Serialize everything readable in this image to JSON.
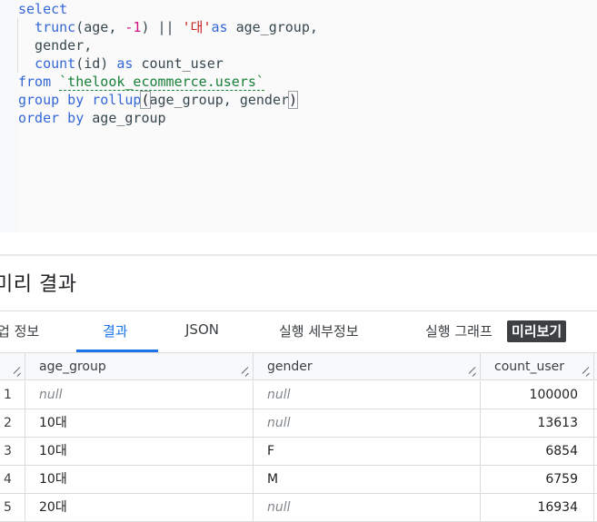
{
  "editor": {
    "lines": [
      [
        {
          "t": "select",
          "c": "kw"
        }
      ],
      [
        {
          "t": "  "
        },
        {
          "t": "trunc",
          "c": "fn"
        },
        {
          "t": "(age, ",
          "c": "plain"
        },
        {
          "t": "-1",
          "c": "num"
        },
        {
          "t": ") || ",
          "c": "plain"
        },
        {
          "t": "'대'",
          "c": "str"
        },
        {
          "t": "as",
          "c": "kw"
        },
        {
          "t": " age_group,",
          "c": "plain"
        }
      ],
      [
        {
          "t": "  gender,",
          "c": "plain"
        }
      ],
      [
        {
          "t": "  "
        },
        {
          "t": "count",
          "c": "fn"
        },
        {
          "t": "(id) ",
          "c": "plain"
        },
        {
          "t": "as",
          "c": "kw"
        },
        {
          "t": " count_user",
          "c": "plain"
        }
      ],
      [
        {
          "t": "from",
          "c": "kw"
        },
        {
          "t": " "
        },
        {
          "t": "`thelook_ecommerce.users`",
          "c": "tbl"
        }
      ],
      [
        {
          "t": "group by",
          "c": "kw"
        },
        {
          "t": " "
        },
        {
          "t": "rollup",
          "c": "fn"
        },
        {
          "t": "(",
          "c": "paren-box"
        },
        {
          "t": "age_group, gender",
          "c": "plain"
        },
        {
          "t": ")",
          "c": "paren-box"
        }
      ],
      [
        {
          "t": "order by",
          "c": "kw"
        },
        {
          "t": " age_group",
          "c": "plain"
        }
      ]
    ]
  },
  "results": {
    "title": "미리 결과",
    "tabs": [
      {
        "label": "업 정보"
      },
      {
        "label": "결과"
      },
      {
        "label": "JSON"
      },
      {
        "label": "실행 세부정보"
      },
      {
        "label": "실행 그래프"
      }
    ],
    "preview_badge": "미리보기",
    "columns": [
      "age_group",
      "gender",
      "count_user"
    ],
    "rows": [
      {
        "num": "1",
        "age_group": "null",
        "gender": "null",
        "count_user": "100000"
      },
      {
        "num": "2",
        "age_group": "10대",
        "gender": "null",
        "count_user": "13613"
      },
      {
        "num": "3",
        "age_group": "10대",
        "gender": "F",
        "count_user": "6854"
      },
      {
        "num": "4",
        "age_group": "10대",
        "gender": "M",
        "count_user": "6759"
      },
      {
        "num": "5",
        "age_group": "20대",
        "gender": "null",
        "count_user": "16934"
      }
    ]
  }
}
